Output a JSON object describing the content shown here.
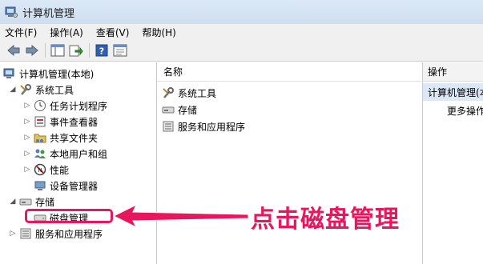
{
  "window": {
    "title": "计算机管理"
  },
  "menu": [
    "文件(F)",
    "操作(A)",
    "查看(V)",
    "帮助(H)"
  ],
  "toolbar": {
    "icons": [
      "back-arrow-icon",
      "forward-arrow-icon",
      "show-tree-icon",
      "export-icon",
      "help-icon",
      "properties-icon"
    ]
  },
  "tree": {
    "root": "计算机管理(本地)",
    "system_tools": "系统工具",
    "task_scheduler": "任务计划程序",
    "event_viewer": "事件查看器",
    "shared_folders": "共享文件夹",
    "local_users": "本地用户和组",
    "performance": "性能",
    "device_manager": "设备管理器",
    "storage": "存储",
    "disk_management": "磁盘管理",
    "services_apps": "服务和应用程序"
  },
  "list": {
    "header": "名称",
    "items": [
      "系统工具",
      "存储",
      "服务和应用程序"
    ]
  },
  "actions": {
    "header": "操作",
    "section": "计算机管理(本",
    "more": "更多操作"
  },
  "annotation": {
    "text": "点击磁盘管理",
    "color": "#e8175d"
  }
}
